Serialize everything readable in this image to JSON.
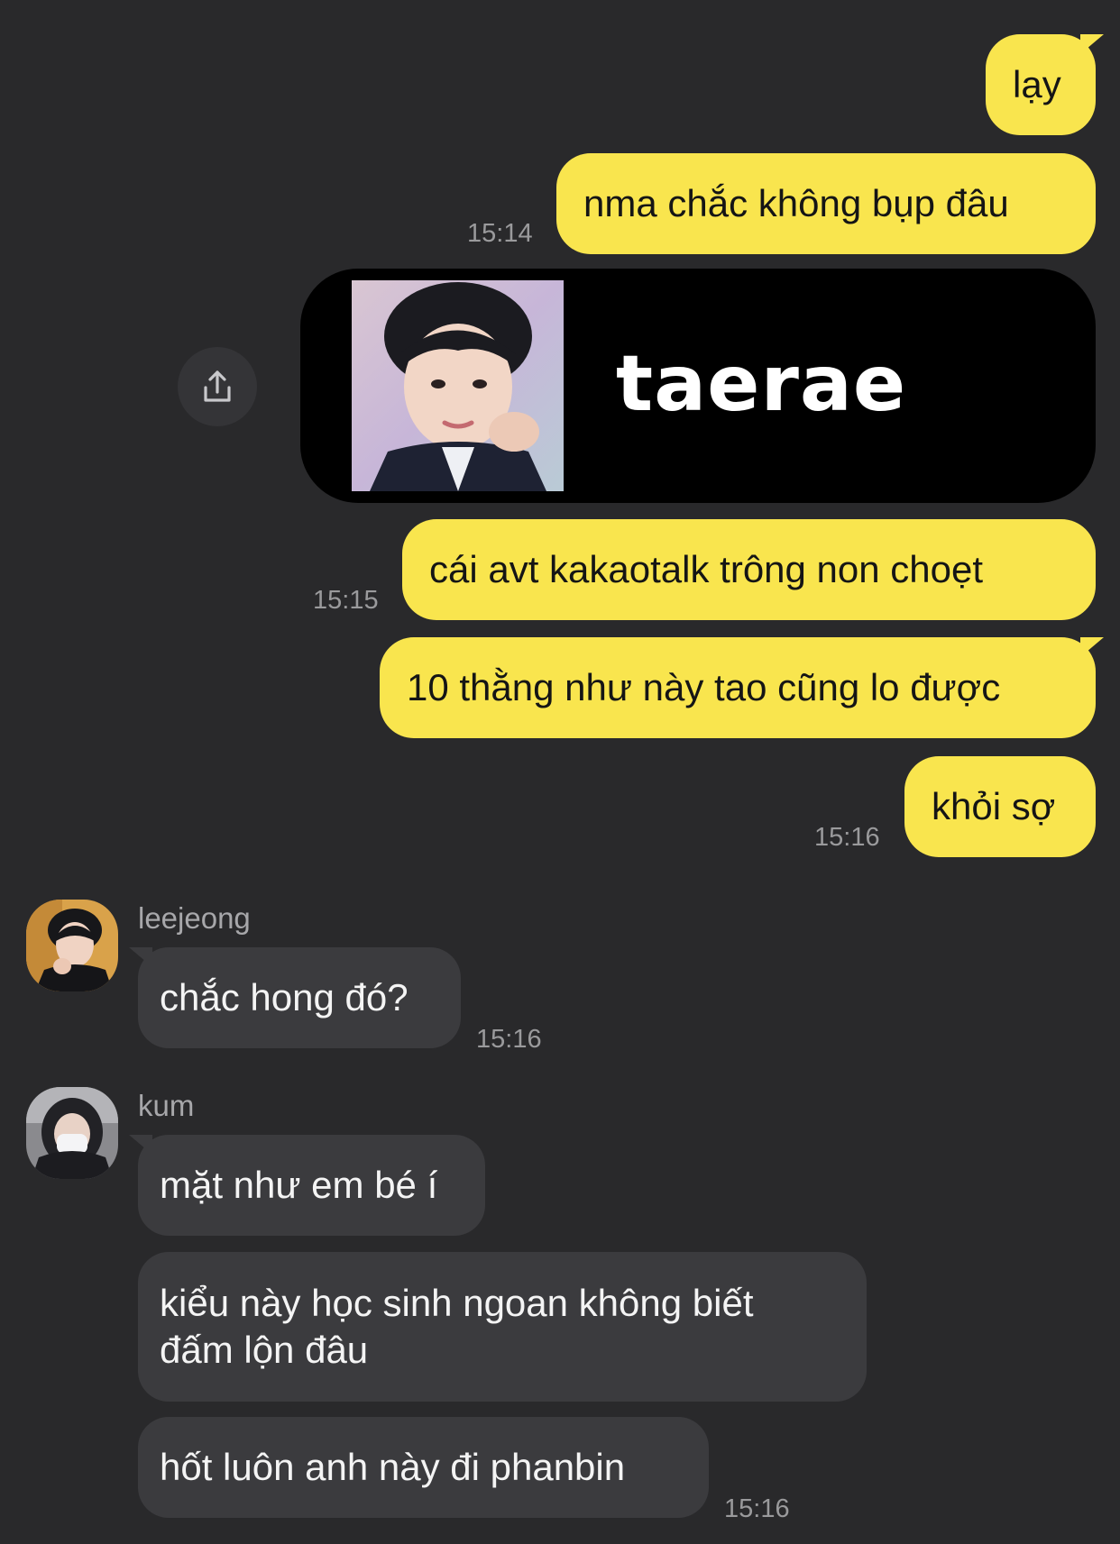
{
  "outgoing": {
    "msg1": "lạy",
    "msg2": "nma chắc không bụp đâu",
    "time1": "15:14",
    "image_card_text": "taerae",
    "msg3": "cái avt kakaotalk trông non choẹt",
    "time2": "15:15",
    "msg4": "10 thằng như này tao cũng lo được",
    "msg5": "khỏi sợ",
    "time3": "15:16"
  },
  "incoming": [
    {
      "sender": "leejeong",
      "messages": [
        "chắc hong đó?"
      ],
      "time": "15:16"
    },
    {
      "sender": "kum",
      "messages": [
        "mặt như em bé í",
        "kiểu này học sinh ngoan không biết",
        "đấm lộn đâu",
        "hốt luôn anh này đi phanbin"
      ],
      "time": "15:16"
    }
  ],
  "icons": {
    "share": "share-icon"
  },
  "colors": {
    "background": "#29292b",
    "outgoing_bubble": "#f9e54e",
    "incoming_bubble": "#3b3b3e",
    "timestamp": "#9a9a9c"
  }
}
